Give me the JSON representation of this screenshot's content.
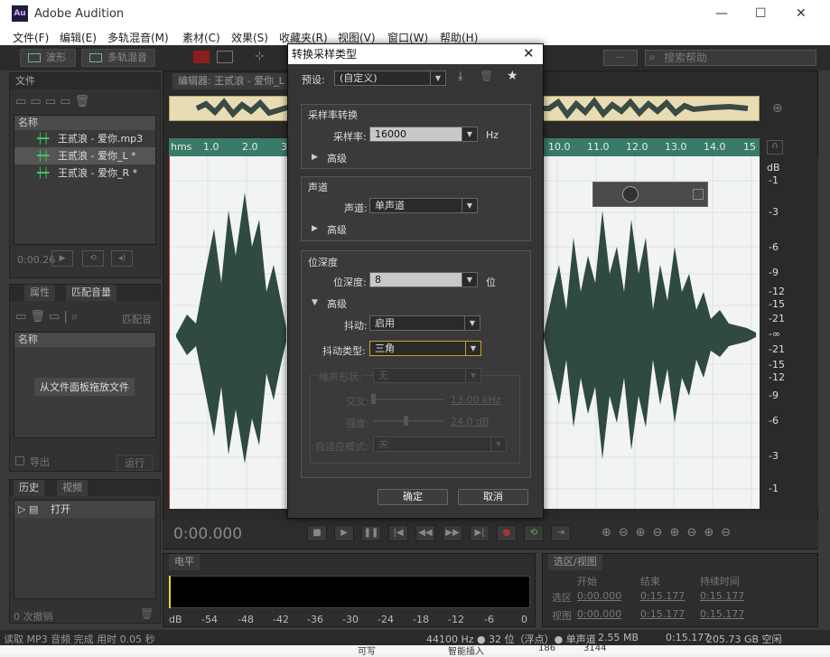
{
  "app": {
    "icon": "Au",
    "title": "Adobe Audition"
  },
  "window_controls": {
    "minimize": "—",
    "maximize": "☐",
    "close": "✕"
  },
  "menu": [
    "文件(F)",
    "编辑(E)",
    "多轨混音(M)",
    "素材(C)",
    "效果(S)",
    "收藏夹(R)",
    "视图(V)",
    "窗口(W)",
    "帮助(H)"
  ],
  "toolbar": {
    "waveform": "波形",
    "multitrack": "多轨混音",
    "dots": "...",
    "search_placeholder": "搜索帮助"
  },
  "files_panel": {
    "tab": "文件",
    "col_name": "名称",
    "items": [
      "王贰浪 - 爱你.mp3",
      "王贰浪 - 爱你_L *",
      "王贰浪 - 爱你_R *"
    ],
    "time": "0:00.26"
  },
  "props_panel": {
    "tab1": "属性",
    "tab2": "匹配音量",
    "match": "匹配音",
    "col_name": "名称",
    "drop_hint": "从文件面板拖放文件",
    "export": "导出",
    "run": "运行"
  },
  "history_panel": {
    "tab1": "历史",
    "tab2": "视频",
    "item": "打开",
    "undo": "0 次撤销"
  },
  "editor": {
    "tab": "编辑器: 王贰浪 - 爱你_L",
    "ruler": [
      "hms",
      "1.0",
      "2.0",
      "3",
      "10.0",
      "11.0",
      "12.0",
      "13.0",
      "14.0",
      "15"
    ],
    "db": [
      "dB",
      "-1",
      "-3",
      "-6",
      "-9",
      "-12",
      "-15",
      "-21",
      "-∞",
      "-21",
      "-15",
      "-12",
      "-9",
      "-6",
      "-3",
      "-1"
    ]
  },
  "transport": {
    "timecode": "0:00.000"
  },
  "meter": {
    "tab": "电平",
    "scale": [
      "dB",
      "-54",
      "-48",
      "-42",
      "-36",
      "-30",
      "-24",
      "-18",
      "-12",
      "-6",
      "0"
    ]
  },
  "selection": {
    "tab": "选区/视图",
    "start": "开始",
    "end": "结束",
    "duration": "持续时间",
    "sel_label": "选区",
    "view_label": "视图",
    "sel_start": "0:00.000",
    "sel_end": "0:15.177",
    "sel_dur": "0:15.177",
    "view_start": "0:00.000",
    "view_end": "0:15.177",
    "view_dur": "0:15.177"
  },
  "status": {
    "left": "读取 MP3 音频 完成 用时 0.05 秒",
    "format": "44100 Hz ● 32 位（浮点）● 单声道",
    "size": "2.55 MB",
    "duration": "0:15.177",
    "space": "205.73 GB 空闲"
  },
  "dialog": {
    "title": "转换采样类型",
    "close": "✕",
    "preset_label": "预设:",
    "preset_value": "(自定义)",
    "rate_group": "采样率转换",
    "rate_label": "采样率:",
    "rate_value": "16000",
    "rate_unit": "Hz",
    "advanced": "高级",
    "channel_group": "声道",
    "channel_label": "声道:",
    "channel_value": "单声道",
    "depth_group": "位深度",
    "depth_label": "位深度:",
    "depth_value": "8",
    "depth_unit": "位",
    "dither_label": "抖动:",
    "dither_value": "启用",
    "dither_type_label": "抖动类型:",
    "dither_type_value": "三角",
    "noise_shape_label": "噪声形状:",
    "noise_shape_value": "无",
    "cross_label": "交叉:",
    "cross_value": "13.00 kHz",
    "strength_label": "强度:",
    "strength_value": "24.0 dB",
    "adaptive_label": "自适应模式:",
    "adaptive_value": "关",
    "ok": "确定",
    "cancel": "取消"
  },
  "bottom_strip": [
    "可写",
    "智能插入",
    "186",
    "3144"
  ]
}
